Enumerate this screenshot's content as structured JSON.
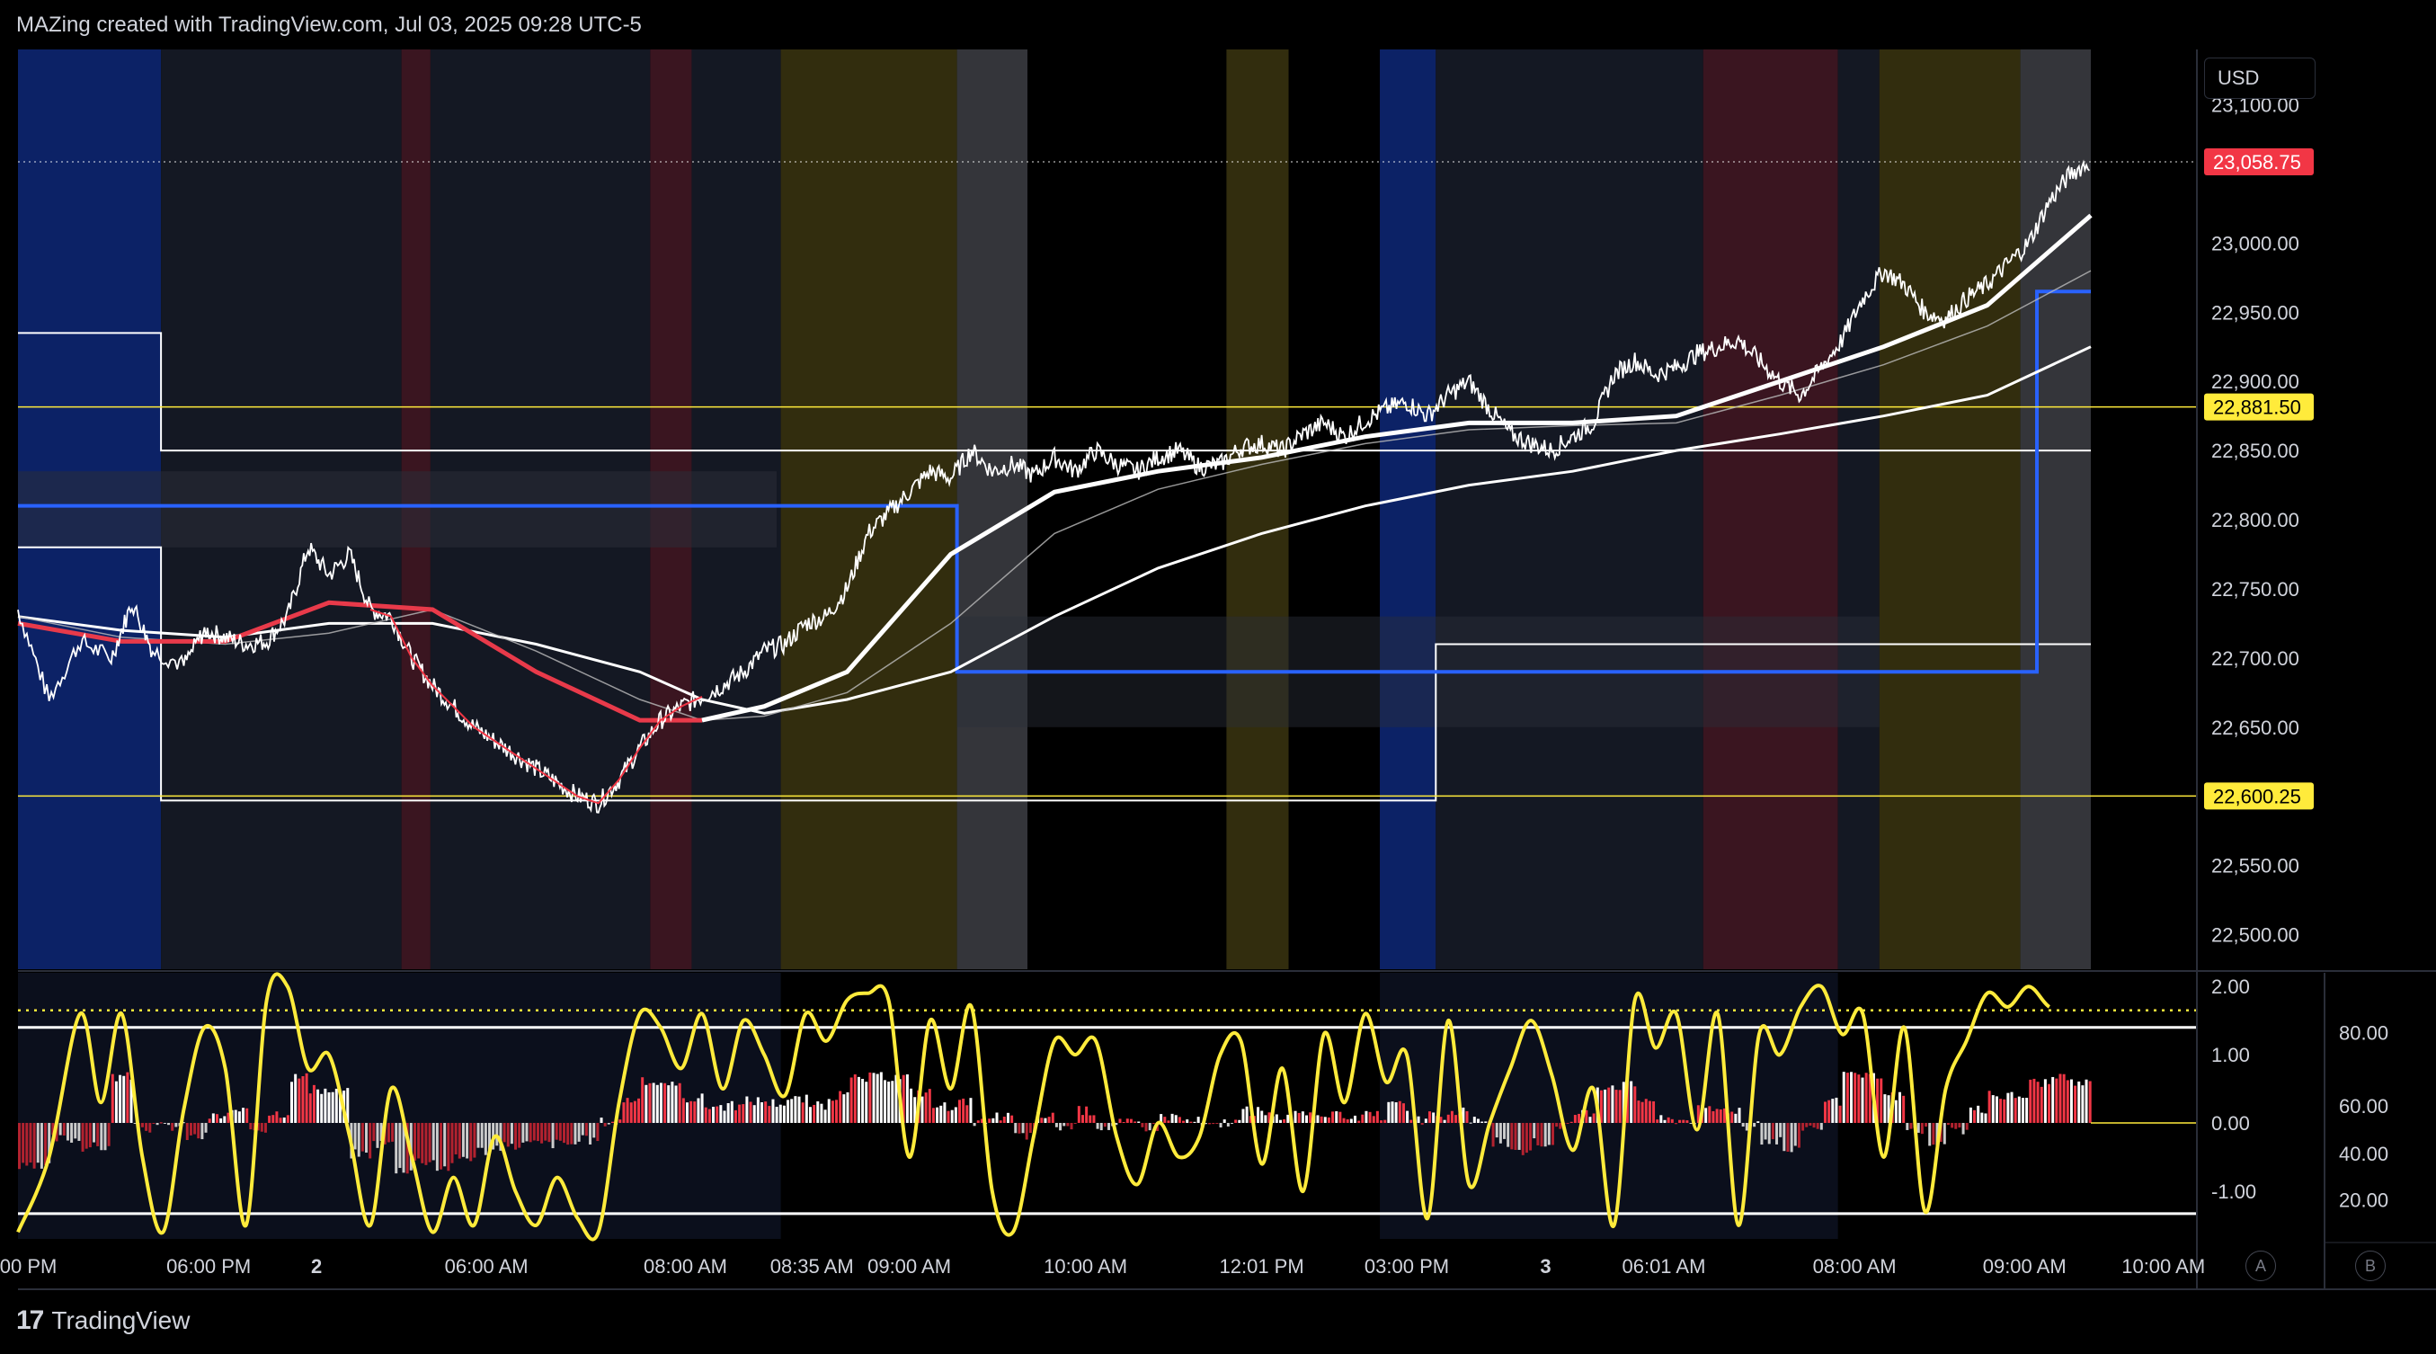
{
  "header": {
    "title": "MAZing created with TradingView.com, Jul 03, 2025 09:28 UTC-5"
  },
  "footer": {
    "brand": "TradingView",
    "brand_mark": "17"
  },
  "currency": "USD",
  "corner_buttons": [
    "A",
    "B"
  ],
  "colors": {
    "background": "#000000",
    "price_up": "#ffffff",
    "price_down": "#f23645",
    "ma_red": "#e83a4a",
    "ma_white": "#ffffff",
    "range_blue": "#2962ff",
    "level_yellow": "#ffeb3b",
    "oscillator": "#ffeb3b",
    "last_price_bg": "#f23645",
    "level_label_bg": "#ffeb3b"
  },
  "chart_data": [
    {
      "type": "line",
      "name": "price-pane",
      "y_ticks": [
        "23,100.00",
        "23,000.00",
        "22,950.00",
        "22,900.00",
        "22,850.00",
        "22,800.00",
        "22,750.00",
        "22,700.00",
        "22,650.00",
        "22,600.00",
        "22,550.00",
        "22,500.00"
      ],
      "y_tick_values": [
        23100,
        23000,
        22950,
        22900,
        22850,
        22800,
        22750,
        22700,
        22650,
        22600,
        22550,
        22500
      ],
      "ylim": [
        22475,
        23140
      ],
      "xlim": [
        0,
        100
      ],
      "x_ticks": [
        {
          "label": "00 PM",
          "x": 0.5
        },
        {
          "label": "06:00 PM",
          "x": 9.2
        },
        {
          "label": "2",
          "x": 14.4
        },
        {
          "label": "06:00 AM",
          "x": 22.6
        },
        {
          "label": "08:00 AM",
          "x": 32.2
        },
        {
          "label": "08:35 AM",
          "x": 38.3
        },
        {
          "label": "09:00 AM",
          "x": 43.0
        },
        {
          "label": "10:00 AM",
          "x": 51.5
        },
        {
          "label": "12:01 PM",
          "x": 60.0
        },
        {
          "label": "03:00 PM",
          "x": 67.0
        },
        {
          "label": "3",
          "x": 73.7
        },
        {
          "label": "06:01 AM",
          "x": 79.4
        },
        {
          "label": "08:00 AM",
          "x": 88.6
        },
        {
          "label": "09:00 AM",
          "x": 96.8
        },
        {
          "label": "10:00 AM",
          "x": 103.5
        }
      ],
      "last_price": {
        "label": "23,058.75",
        "value": 23058.75
      },
      "levels": [
        {
          "label": "22,881.50",
          "value": 22881.5
        },
        {
          "label": "22,600.25",
          "value": 22600.25
        }
      ],
      "price_series": {
        "x": [
          0,
          1.5,
          3,
          4.5,
          5.5,
          6.5,
          8,
          9,
          10,
          11,
          12,
          13,
          14,
          15,
          16,
          17,
          18,
          19,
          20,
          21,
          22,
          23,
          24,
          25,
          26,
          27,
          28,
          29,
          30,
          31,
          32,
          33,
          34,
          35,
          36,
          37,
          38,
          39,
          40,
          41,
          42,
          43,
          44,
          45,
          46,
          47,
          48,
          49,
          50,
          51,
          52,
          53,
          54,
          55,
          56,
          57,
          58,
          59,
          60,
          61,
          62,
          63,
          64,
          65,
          66,
          67,
          68,
          69,
          70,
          71,
          72,
          73,
          74,
          75,
          76,
          77,
          78,
          79,
          80,
          81,
          82,
          83,
          84,
          85,
          86,
          87,
          88,
          89,
          90,
          91,
          92,
          93,
          94,
          95,
          96,
          97,
          98,
          99,
          100
        ],
        "y": [
          22735,
          22670,
          22712,
          22700,
          22740,
          22705,
          22695,
          22720,
          22715,
          22710,
          22712,
          22730,
          22780,
          22760,
          22775,
          22735,
          22730,
          22700,
          22680,
          22665,
          22650,
          22640,
          22630,
          22620,
          22610,
          22600,
          22595,
          22612,
          22635,
          22655,
          22665,
          22672,
          22680,
          22690,
          22705,
          22710,
          22725,
          22730,
          22750,
          22790,
          22805,
          22820,
          22835,
          22830,
          22850,
          22835,
          22840,
          22832,
          22845,
          22835,
          22850,
          22840,
          22835,
          22845,
          22850,
          22838,
          22840,
          22852,
          22855,
          22850,
          22862,
          22870,
          22860,
          22872,
          22880,
          22885,
          22875,
          22890,
          22900,
          22880,
          22862,
          22855,
          22850,
          22860,
          22870,
          22905,
          22915,
          22905,
          22910,
          22920,
          22925,
          22930,
          22915,
          22900,
          22890,
          22910,
          22930,
          22960,
          22980,
          22970,
          22950,
          22945,
          22960,
          22970,
          22985,
          23000,
          23030,
          23050,
          23059
        ]
      },
      "ma_fast": {
        "x": [
          0,
          5,
          10,
          15,
          20,
          25,
          30,
          33,
          36,
          40,
          45,
          50,
          55,
          60,
          65,
          70,
          75,
          80,
          85,
          90,
          95,
          100
        ],
        "y": [
          22725,
          22712,
          22712,
          22740,
          22735,
          22690,
          22655,
          22655,
          22665,
          22690,
          22775,
          22820,
          22835,
          22845,
          22860,
          22870,
          22870,
          22875,
          22900,
          22925,
          22955,
          23020
        ]
      },
      "ma_mid": {
        "x": [
          0,
          5,
          10,
          15,
          20,
          25,
          30,
          33,
          36,
          40,
          45,
          50,
          55,
          60,
          65,
          70,
          75,
          80,
          85,
          90,
          95,
          100
        ],
        "y": [
          22730,
          22715,
          22710,
          22718,
          22735,
          22705,
          22670,
          22655,
          22658,
          22675,
          22725,
          22790,
          22822,
          22840,
          22855,
          22865,
          22868,
          22870,
          22890,
          22912,
          22940,
          22980
        ]
      },
      "ma_slow": {
        "x": [
          0,
          5,
          10,
          15,
          20,
          25,
          30,
          33,
          36,
          40,
          45,
          50,
          55,
          60,
          65,
          70,
          75,
          80,
          85,
          90,
          95,
          100
        ],
        "y": [
          22730,
          22720,
          22715,
          22725,
          22725,
          22710,
          22690,
          22670,
          22660,
          22670,
          22690,
          22730,
          22765,
          22790,
          22810,
          22825,
          22835,
          22850,
          22862,
          22875,
          22890,
          22925
        ]
      },
      "session_bands": [
        {
          "x0": 0.0,
          "x1": 6.9,
          "color": "#0c2266"
        },
        {
          "x0": 6.9,
          "x1": 18.5,
          "color": "#141823"
        },
        {
          "x0": 18.5,
          "x1": 19.9,
          "color": "#3a1520"
        },
        {
          "x0": 19.9,
          "x1": 30.5,
          "color": "#141823"
        },
        {
          "x0": 30.5,
          "x1": 32.5,
          "color": "#3a1520"
        },
        {
          "x0": 32.5,
          "x1": 36.8,
          "color": "#141823"
        },
        {
          "x0": 36.8,
          "x1": 45.3,
          "color": "#322d0e"
        },
        {
          "x0": 45.3,
          "x1": 48.7,
          "color": "#34353a"
        },
        {
          "x0": 48.7,
          "x1": 58.3,
          "color": "#000000"
        },
        {
          "x0": 58.3,
          "x1": 61.3,
          "color": "#322d0e"
        },
        {
          "x0": 61.3,
          "x1": 65.7,
          "color": "#000000"
        },
        {
          "x0": 65.7,
          "x1": 68.4,
          "color": "#0c2266"
        },
        {
          "x0": 68.4,
          "x1": 81.3,
          "color": "#141823"
        },
        {
          "x0": 81.3,
          "x1": 87.8,
          "color": "#3a1520"
        },
        {
          "x0": 87.8,
          "x1": 89.8,
          "color": "#141823"
        },
        {
          "x0": 89.8,
          "x1": 96.6,
          "color": "#322d0e"
        },
        {
          "x0": 96.6,
          "x1": 100.0,
          "color": "#34353a"
        }
      ]
    },
    {
      "type": "line",
      "name": "oscillator-pane",
      "y_ticks": [
        "2.00",
        "1.00",
        "0.00",
        "-1.00"
      ],
      "y_tick_values": [
        2,
        1,
        0,
        -1
      ],
      "y_ticks_right": [
        "80.00",
        "60.00",
        "40.00",
        "20.00"
      ],
      "ylim": [
        -1.7,
        2.2
      ],
      "xlim": [
        0,
        100
      ],
      "hlines": [
        1.4,
        -1.33
      ],
      "dotted_level": 1.65,
      "oscillator": {
        "x": [
          0,
          1.5,
          3,
          4,
          5,
          6,
          7,
          8,
          9,
          10,
          11,
          12,
          13,
          14,
          15,
          16,
          17,
          18,
          19,
          20,
          21,
          22,
          23,
          24,
          25,
          26,
          27,
          28,
          29,
          30,
          31,
          32,
          33,
          34,
          35,
          36,
          37,
          38,
          39,
          40,
          41,
          42,
          43,
          44,
          45,
          46,
          47,
          48,
          49,
          50,
          51,
          52,
          53,
          54,
          55,
          56,
          57,
          58,
          59,
          60,
          61,
          62,
          63,
          64,
          65,
          66,
          67,
          68,
          69,
          70,
          71,
          72,
          73,
          74,
          75,
          76,
          77,
          78,
          79,
          80,
          81,
          82,
          83,
          84,
          85,
          86,
          87,
          88,
          89,
          90,
          91,
          92,
          93,
          94,
          95,
          96,
          97,
          98,
          99,
          100
        ],
        "y": [
          -1.6,
          -0.5,
          1.6,
          0.3,
          1.6,
          -0.5,
          -1.6,
          0.2,
          1.4,
          0.8,
          -1.5,
          1.8,
          2.0,
          0.8,
          1.0,
          -0.2,
          -1.5,
          0.5,
          -0.5,
          -1.6,
          -0.8,
          -1.5,
          -0.2,
          -1.0,
          -1.5,
          -0.8,
          -1.4,
          -1.6,
          0.3,
          1.6,
          1.4,
          0.8,
          1.6,
          0.5,
          1.5,
          1.0,
          0.4,
          1.6,
          1.2,
          1.8,
          1.9,
          1.8,
          -0.5,
          1.5,
          0.5,
          1.7,
          -1.0,
          -1.6,
          -0.2,
          1.2,
          1.0,
          1.2,
          -0.2,
          -0.9,
          0.0,
          -0.5,
          -0.2,
          1.0,
          1.2,
          -0.6,
          0.8,
          -1.0,
          1.3,
          0.3,
          1.6,
          0.6,
          1.0,
          -1.4,
          1.5,
          -0.9,
          0.0,
          0.8,
          1.5,
          0.7,
          -0.4,
          0.5,
          -1.5,
          1.8,
          1.1,
          1.6,
          -0.1,
          1.6,
          -1.5,
          1.3,
          1.0,
          1.7,
          2.0,
          1.3,
          1.6,
          -0.5,
          1.4,
          -1.3,
          0.5,
          1.2,
          1.9,
          1.7,
          2.0,
          1.7,
          1.65
        ]
      },
      "histogram_scale": 0.5
    }
  ]
}
